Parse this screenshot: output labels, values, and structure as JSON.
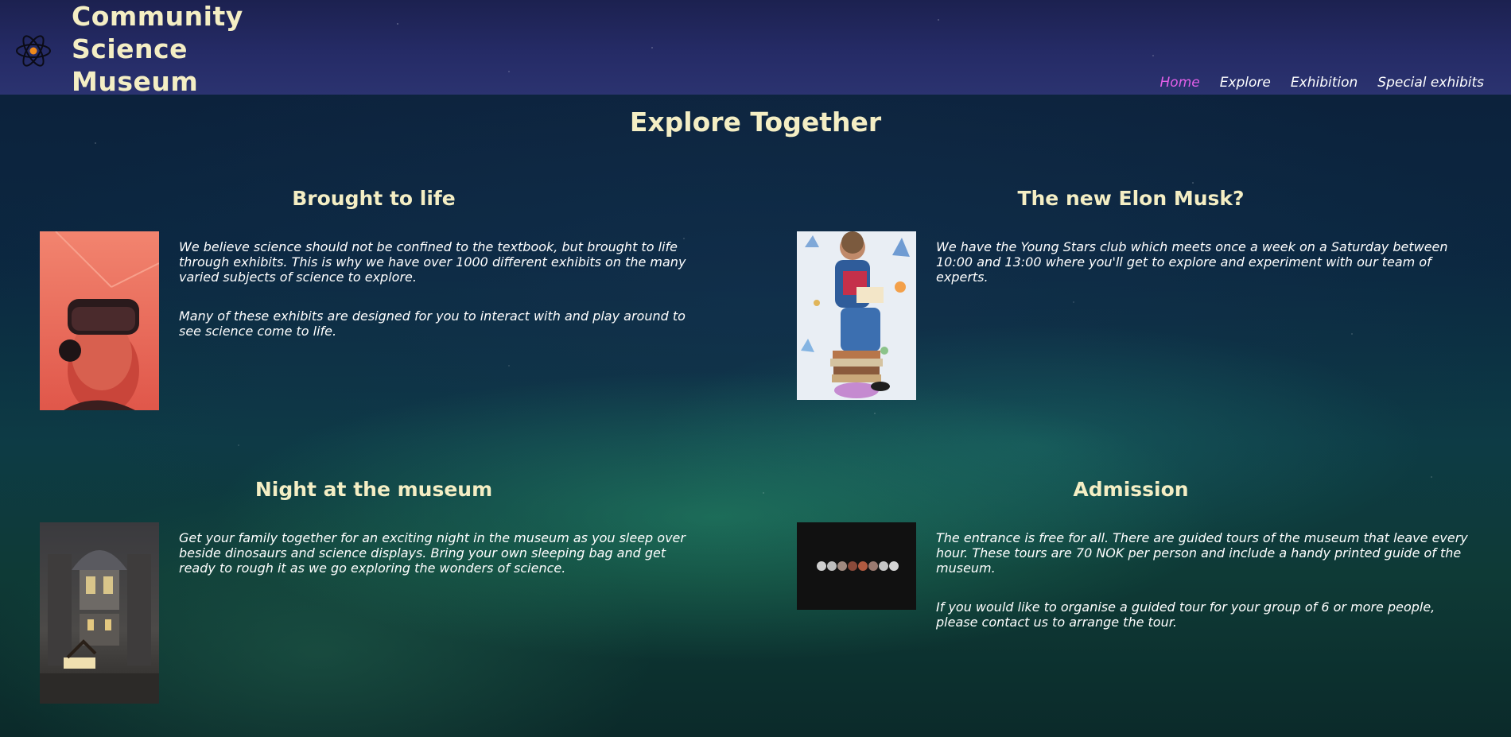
{
  "header": {
    "brand_line1": "Community",
    "brand_line2": "Science",
    "brand_line3": "Museum",
    "nav": [
      "Home",
      "Explore",
      "Exhibition",
      "Special exhibits"
    ],
    "active_nav": "Home"
  },
  "page_title": "Explore Together",
  "cards": [
    {
      "title": "Brought to life",
      "paragraphs": [
        "We believe science should not be confined to the textbook, but brought to life through exhibits. This is why we have over 1000 different exhibits on the many varied subjects of science to explore.",
        "Many of these exhibits are designed for you to interact with and play around to see science come to life."
      ],
      "image": "vr-headset-child-photo"
    },
    {
      "title": "The new Elon Musk?",
      "paragraphs": [
        "We have the Young Stars club which meets once a week on a Saturday between 10:00 and 13:00 where you'll get to explore and experiment with our team of experts."
      ],
      "image": "boy-reading-on-books-photo"
    },
    {
      "title": "Night at the museum",
      "paragraphs": [
        "Get your family together for an exciting night in the museum as you sleep over beside dinosaurs and science displays. Bring your own sleeping bag and get ready to rough it as we go exploring the wonders of science."
      ],
      "image": "museum-hall-photo"
    },
    {
      "title": "Admission",
      "paragraphs": [
        "The entrance is free for all. There are guided tours of the museum that leave every hour. These tours are 70 NOK per person and include a handy printed guide of the museum.",
        "If you would like to organise a guided tour for your group of 6 or more people, please contact us to arrange the tour."
      ],
      "image": "lunar-eclipse-phases-photo"
    }
  ],
  "colors": {
    "heading": "#f4eec4",
    "active_nav": "#e25fe8",
    "body_text": "#ffffff",
    "header_bg": "#252b66"
  }
}
